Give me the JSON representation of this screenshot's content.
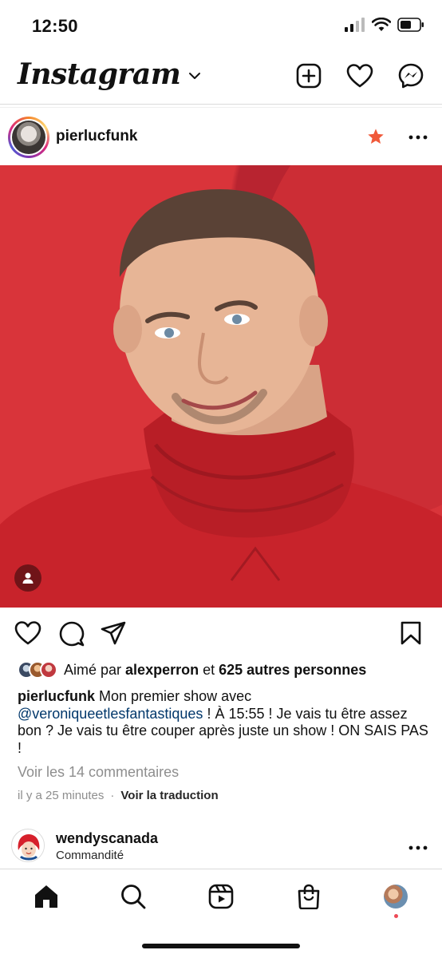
{
  "status_bar": {
    "time": "12:50"
  },
  "header": {
    "logo": "Instagram",
    "icons": [
      "chevron-down-icon",
      "new-post-icon",
      "heart-icon",
      "messenger-icon"
    ]
  },
  "post": {
    "username": "pierlucfunk",
    "image_description_colors": {
      "background": "#d9343a",
      "sweater": "#c8232b"
    },
    "likes": {
      "prefix": "Aimé par",
      "first_liker": "alexperron",
      "connector": "et",
      "others": "625 autres personnes"
    },
    "caption": {
      "username": "pierlucfunk",
      "text_before_mention": "Mon premier show avec",
      "mention": "@veroniqueetlesfantastiques",
      "text_after_mention": "! À 15:55 ! Je vais tu être assez bon ? Je vais tu être couper après juste un show ! ON SAIS PAS !"
    },
    "view_comments": "Voir les 14 commentaires",
    "time_ago": "il y a 25 minutes",
    "meta_separator": "·",
    "translate": "Voir la traduction"
  },
  "next_post": {
    "username": "wendyscanada",
    "sponsored_label": "Commandité"
  },
  "colors": {
    "accent_blue": "#00376b",
    "muted": "#8e8e8e",
    "notification_red": "#ed4956",
    "star_orange": "#f0593a"
  }
}
